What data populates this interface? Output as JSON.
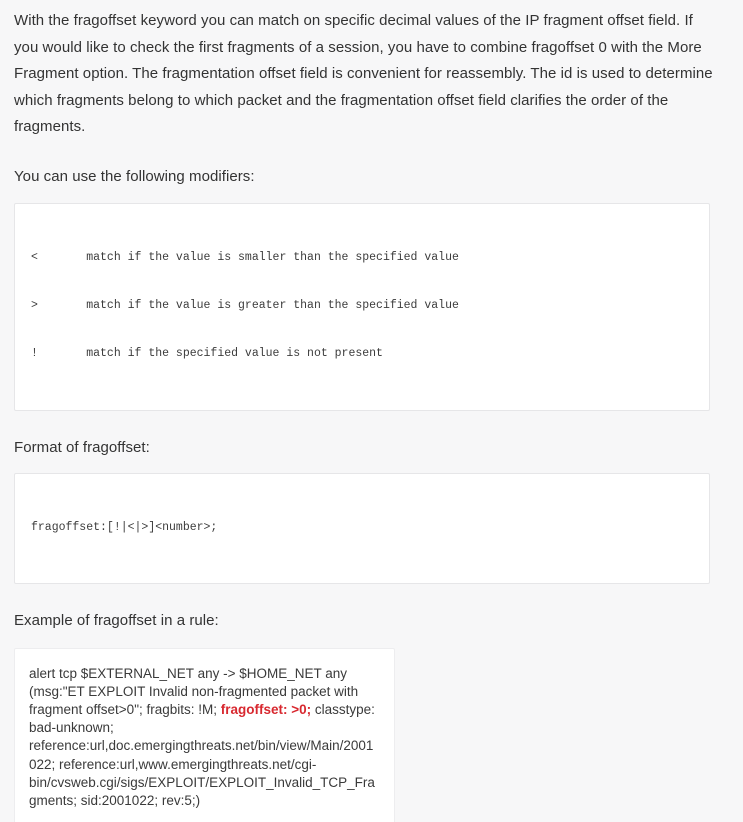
{
  "document": {
    "intro_paragraph": "With the fragoffset keyword you can match on specific decimal values of the IP fragment offset field. If you would like to check the first fragments of a session, you have to combine fragoffset 0 with the More Fragment option. The fragmentation offset field is convenient for reassembly. The id is used to determine which fragments belong to which packet and the fragmentation offset field clarifies the order of the fragments.",
    "modifiers_intro": "You can use the following modifiers:",
    "modifiers_code": {
      "lines": [
        "<       match if the value is smaller than the specified value",
        ">       match if the value is greater than the specified value",
        "!       match if the specified value is not present"
      ],
      "line_1": "<       match if the value is smaller than the specified value",
      "line_2": ">       match if the value is greater than the specified value",
      "line_3": "!       match if the specified value is not present"
    },
    "format_label": "Format of fragoffset:",
    "format_code": "fragoffset:[!|<|>]<number>;",
    "example_label": "Example of fragoffset in a rule:",
    "example_rule": {
      "before_highlight": "alert tcp $EXTERNAL_NET any -> $HOME_NET any (msg:\"ET EXPLOIT Invalid non-fragmented packet with fragment offset>0\"; fragbits: !M; ",
      "highlight": "fragoffset: >0;",
      "after_highlight": " classtype: bad-unknown; reference:url,doc.emergingthreats.net/bin/view/Main/2001022; reference:url,www.emergingthreats.net/cgi-bin/cvsweb.cgi/sigs/EXPLOIT/EXPLOIT_Invalid_TCP_Fragments; sid:2001022; rev:5;)"
    }
  },
  "colors": {
    "page_background": "#f7f7f8",
    "body_text": "#333333",
    "code_background": "#ffffff",
    "code_border": "#e6e6e8",
    "code_text": "#3c3c3c",
    "highlight_red": "#d8282f"
  }
}
